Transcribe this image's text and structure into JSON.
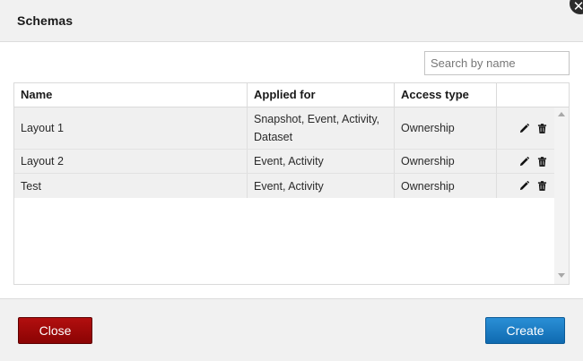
{
  "dialog": {
    "title": "Schemas",
    "close_icon": "close-icon"
  },
  "search": {
    "placeholder": "Search by name",
    "value": ""
  },
  "table": {
    "columns": {
      "name": "Name",
      "applied_for": "Applied for",
      "access_type": "Access type",
      "actions": ""
    },
    "rows": [
      {
        "name": "Layout 1",
        "applied_for": "Snapshot, Event, Activity, Dataset",
        "access_type": "Ownership"
      },
      {
        "name": "Layout 2",
        "applied_for": "Event, Activity",
        "access_type": "Ownership"
      },
      {
        "name": "Test",
        "applied_for": "Event, Activity",
        "access_type": "Ownership"
      }
    ],
    "row_actions": [
      "pencil-icon",
      "trash-icon"
    ]
  },
  "footer": {
    "close_label": "Close",
    "create_label": "Create"
  },
  "colors": {
    "close_button": "#9b0a0a",
    "create_button": "#1a7cc3",
    "header_bg": "#f1f1f1",
    "row_bg": "#f0f0f0"
  }
}
